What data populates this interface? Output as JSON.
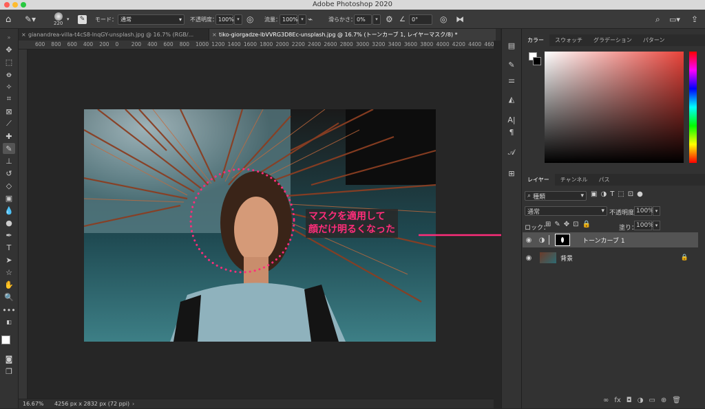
{
  "app": {
    "title": "Adobe Photoshop 2020"
  },
  "options": {
    "brush_size": "220",
    "mode_label": "モード：",
    "mode_value": "通常",
    "opacity_label": "不透明度：",
    "opacity_value": "100%",
    "flow_label": "流量：",
    "flow_value": "100%",
    "smoothing_label": "滑らかさ：",
    "smoothing_value": "0%",
    "angle_value": "0°"
  },
  "tabs": [
    {
      "label": "gianandrea-villa-t4cS8-lnqGY-unsplash.jpg @ 16.7% (RGB/..."
    },
    {
      "label": "tiko-giorgadze-lbVVRG3D8Ec-unsplash.jpg @ 16.7% (トーンカーブ 1, レイヤーマスク/8) *"
    }
  ],
  "ruler_ticks": [
    "600",
    "800",
    "600",
    "400",
    "200",
    "0",
    "200",
    "400",
    "600",
    "800",
    "1000",
    "1200",
    "1400",
    "1600",
    "1800",
    "2000",
    "2200",
    "2400",
    "2600",
    "2800",
    "3000",
    "3200",
    "3400",
    "3600",
    "3800",
    "4000",
    "4200",
    "4400",
    "4600",
    "4800"
  ],
  "status": {
    "zoom": "16.67%",
    "info": "4256 px x 2832 px (72 ppi)"
  },
  "annotation": {
    "line1": "マスクを適用して",
    "line2": "顔だけ明るくなった",
    "color": "#ff2d7a"
  },
  "color_panel": {
    "tabs": [
      "カラー",
      "スウォッチ",
      "グラデーション",
      "パターン"
    ],
    "hue_color": "#e8433a"
  },
  "layers_panel": {
    "tabs": [
      "レイヤー",
      "チャンネル",
      "パス"
    ],
    "filter_kind": "種類",
    "blend_mode": "通常",
    "opacity_label": "不透明度：",
    "opacity_value": "100%",
    "lock_label": "ロック：",
    "fill_label": "塗り：",
    "fill_value": "100%",
    "layers": [
      {
        "name": "トーンカーブ 1"
      },
      {
        "name": "背景"
      }
    ]
  }
}
